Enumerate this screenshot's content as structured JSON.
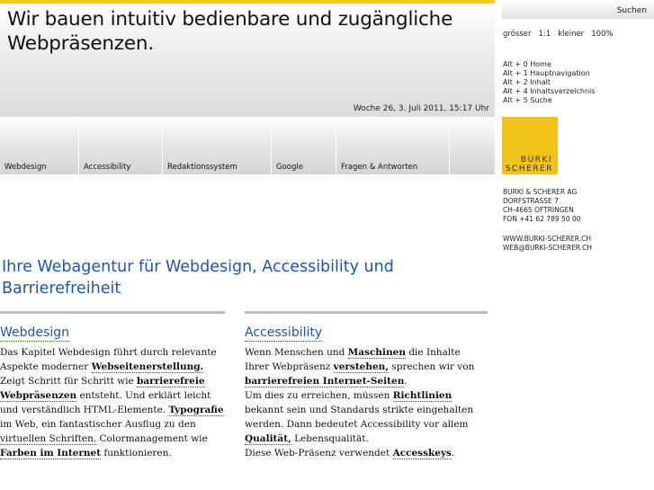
{
  "header": {
    "tagline": "Wir bauen intuitiv bedienbare und zugängliche Webpräsenzen.",
    "date": "Woche 26, 3. Juli 2011, 15:17 Uhr"
  },
  "nav": [
    {
      "label": "Webdesign"
    },
    {
      "label": "Accessibility"
    },
    {
      "label": "Redaktionssystem"
    },
    {
      "label": "Google"
    },
    {
      "label": "Fragen & Antworten"
    },
    {
      "label": ""
    }
  ],
  "sidebar": {
    "search_label": "Suchen",
    "size": {
      "bigger": "grösser",
      "normal": "1:1",
      "smaller": "kleiner",
      "zoom": "100%"
    },
    "accesskeys": [
      "Alt + 0 Home",
      "Alt + 1 Hauptnavigation",
      "Alt + 2 Inhalt",
      "Alt + 4 Inhaltsverzeichnis",
      "Alt + 5 Suche"
    ],
    "logo": {
      "line1": "BURKI",
      "line2": "SCHERER"
    },
    "address": [
      "BURKI & SCHERER AG",
      "DORFSTRASSE 7",
      "CH-4665 OFTRINGEN",
      "FON +41 62 789 50 00"
    ],
    "contact": [
      "WWW.BURKI-SCHERER.CH",
      "WEB@BURKI-SCHERER.CH"
    ]
  },
  "main": {
    "title": "Ihre Webagentur für Webdesign, Accessibility und Barrierefreiheit",
    "webdesign": {
      "heading": "Webdesign",
      "t1": "Das Kapitel Webdesign führt durch relevante Aspekte moderner ",
      "b1": "Webseitenerstellung.",
      "t2": " Zeigt Schritt für Schritt wie ",
      "b2": "barrierefreie Webpräsenzen",
      "t3": " entsteht. Und erklärt leicht und verständlich HTML-Elemente. ",
      "b3": "Typografie",
      "t4": " im Web, ein fantastischer Ausflug zu den ",
      "l1": "virtuellen Schriften.",
      "t5": " Colormanagement wie ",
      "b4": "Farben im Internet",
      "t6": " funktionieren."
    },
    "accessibility": {
      "heading": "Accessibility",
      "t1": "Wenn Menschen und ",
      "b1": "Maschinen",
      "t2": " die Inhalte Ihrer Webpräsenz ",
      "b2": "verstehen,",
      "t3": " sprechen wir von ",
      "b3": "barrierefreien Internet-Seiten",
      "t4": ".",
      "t5": "Um dies zu erreichen, müssen ",
      "b4": "Richtlinien",
      "t6": " bekannt sein und Standards strikte eingehalten werden. Dann bedeutet Accessibility vor allem ",
      "b5": "Qualität,",
      "t7": " Lebensqualität.",
      "t8": "Diese Web-Präsenz verwendet ",
      "b6": "Accesskeys",
      "t9": "."
    }
  }
}
